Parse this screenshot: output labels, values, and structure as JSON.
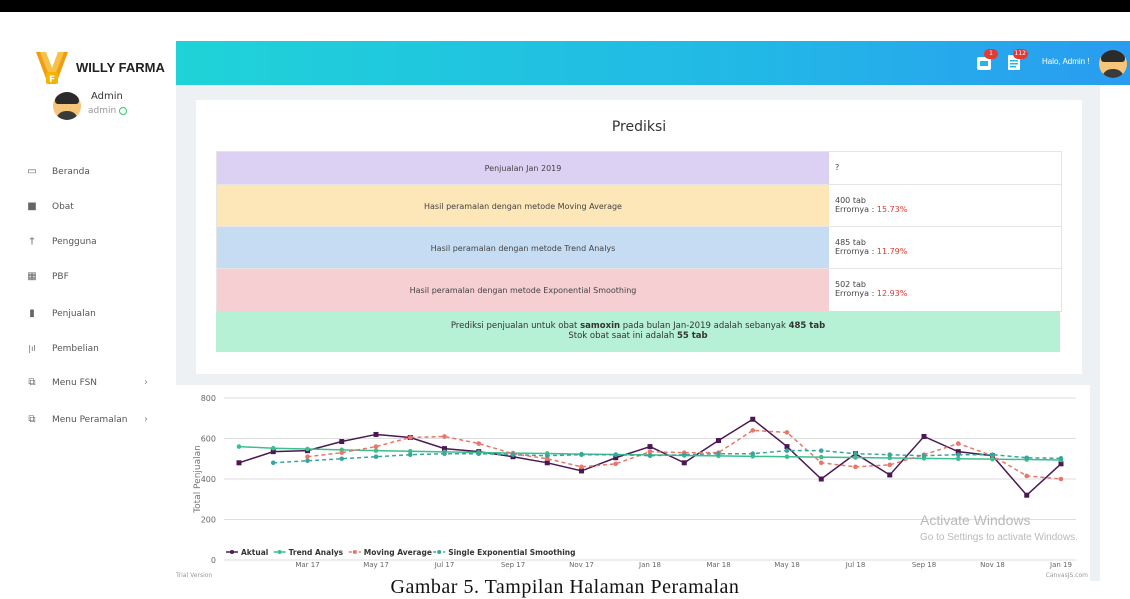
{
  "brand": {
    "name": "WILLY FARMA"
  },
  "user": {
    "name": "Admin",
    "role": "admin"
  },
  "header": {
    "greeting": "Halo, Admin !",
    "badge_cart": "1",
    "badge_doc": "112"
  },
  "sidebar": {
    "items": [
      {
        "label": "Beranda",
        "icon": "monitor-icon"
      },
      {
        "label": "Obat",
        "icon": "briefcase-icon"
      },
      {
        "label": "Pengguna",
        "icon": "person-icon"
      },
      {
        "label": "PBF",
        "icon": "building-icon"
      },
      {
        "label": "Penjualan",
        "icon": "chart-bar-icon"
      },
      {
        "label": "Pembelian",
        "icon": "bar-chart-icon"
      },
      {
        "label": "Menu FSN",
        "icon": "copy-icon",
        "chev": "›"
      },
      {
        "label": "Menu Peramalan",
        "icon": "copy-icon",
        "chev": "›"
      }
    ]
  },
  "prediction": {
    "title": "Prediksi",
    "rows": [
      {
        "label": "Penjualan Jan 2019",
        "value": "?",
        "error_prefix": "",
        "error": ""
      },
      {
        "label": "Hasil peramalan dengan metode Moving Average",
        "value": "400 tab",
        "error_prefix": "Errornya : ",
        "error": "15.73%"
      },
      {
        "label": "Hasil peramalan dengan metode Trend Analys",
        "value": "485 tab",
        "error_prefix": "Errornya : ",
        "error": "11.79%"
      },
      {
        "label": "Hasil peramalan dengan metode Exponential Smoothing",
        "value": "502 tab",
        "error_prefix": "Errornya : ",
        "error": "12.93%"
      }
    ],
    "summary": {
      "p1": "Prediksi penjualan untuk obat ",
      "drug": "samoxin",
      "p2": " pada bulan Jan-2019 adalah sebanyak ",
      "pred": "485 tab",
      "p3": "Stok obat saat ini adalah ",
      "stock": "55 tab"
    },
    "colors": {
      "row0": "#dcd0f3",
      "row1": "#fde6b8",
      "row2": "#c5dcf3",
      "row3": "#f5cfd1",
      "summary": "#b6f0d5"
    }
  },
  "chart_data": {
    "type": "line",
    "ylabel": "Total Penjualan",
    "ylim": [
      0,
      800
    ],
    "yticks": [
      0,
      200,
      400,
      600,
      800
    ],
    "xticks": [
      "Mar 17",
      "May 17",
      "Jul 17",
      "Sep 17",
      "Nov 17",
      "Jan 18",
      "Mar 18",
      "May 18",
      "Jul 18",
      "Sep 18",
      "Nov 18",
      "Jan 19"
    ],
    "x": [
      "Jan 17",
      "Feb 17",
      "Mar 17",
      "Apr 17",
      "May 17",
      "Jun 17",
      "Jul 17",
      "Aug 17",
      "Sep 17",
      "Oct 17",
      "Nov 17",
      "Dec 17",
      "Jan 18",
      "Feb 18",
      "Mar 18",
      "Apr 18",
      "May 18",
      "Jun 18",
      "Jul 18",
      "Aug 18",
      "Sep 18",
      "Oct 18",
      "Nov 18",
      "Dec 18",
      "Jan 19"
    ],
    "series": [
      {
        "name": "Aktual",
        "color": "#4b1855",
        "dash": "",
        "values": [
          480,
          535,
          540,
          585,
          620,
          605,
          550,
          535,
          510,
          480,
          440,
          505,
          560,
          480,
          590,
          695,
          560,
          400,
          525,
          420,
          610,
          535,
          515,
          320,
          475
        ]
      },
      {
        "name": "Trend Analys",
        "color": "#3cbf8c",
        "dash": "",
        "values": [
          560,
          552,
          548,
          544,
          540,
          537,
          534,
          531,
          528,
          526,
          523,
          521,
          519,
          516,
          514,
          512,
          510,
          508,
          506,
          504,
          502,
          500,
          498,
          496,
          494
        ]
      },
      {
        "name": "Moving Average",
        "color": "#e8776a",
        "dash": "4,3",
        "values": [
          null,
          null,
          510,
          530,
          560,
          605,
          610,
          575,
          525,
          500,
          460,
          475,
          535,
          530,
          530,
          640,
          630,
          480,
          460,
          470,
          520,
          575,
          515,
          415,
          400
        ]
      },
      {
        "name": "Single Exponential Smoothing",
        "color": "#3aa59c",
        "dash": "4,3",
        "values": [
          null,
          480,
          490,
          500,
          510,
          520,
          525,
          525,
          520,
          515,
          520,
          520,
          515,
          520,
          525,
          525,
          540,
          540,
          525,
          520,
          515,
          520,
          520,
          505,
          502
        ]
      }
    ],
    "legend_position": "bottom-left",
    "footer_left": "Trial Version",
    "footer_right": "CanvasJS.com"
  },
  "watermark": {
    "line1": "Activate Windows",
    "line2": "Go to Settings to activate Windows."
  },
  "caption": "Gambar 5. Tampilan Halaman Peramalan"
}
